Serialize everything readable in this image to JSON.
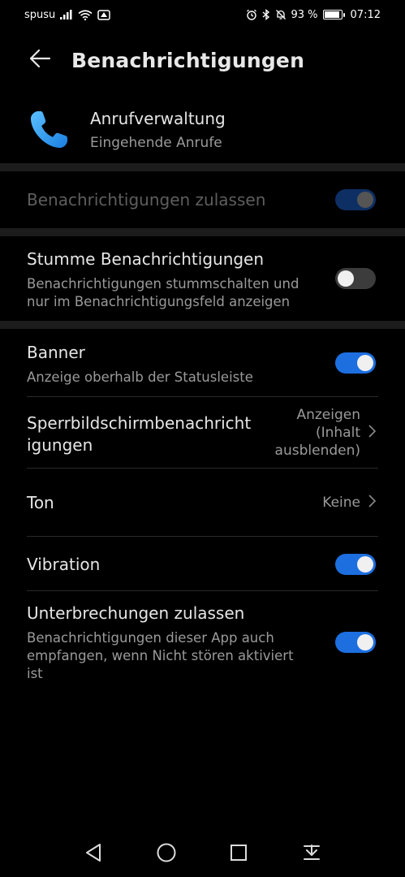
{
  "status_bar": {
    "carrier": "spusu",
    "battery": "93 %",
    "battery_level": 0.93,
    "time": "07:12"
  },
  "header": {
    "title": "Benachrichtigungen",
    "back_icon": "arrow-left-icon"
  },
  "app": {
    "name": "Anrufverwaltung",
    "subtitle": "Eingehende Anrufe",
    "icon": "phone-handset-icon",
    "icon_color": "#2a9df4"
  },
  "settings": {
    "allow": {
      "title": "Benachrichtigungen zulassen",
      "state": "on",
      "enabled": false
    },
    "silent": {
      "title": "Stumme Benachrichtigungen",
      "subtitle_line1": "Benachrichtigungen stummschalten und",
      "subtitle_line2": "nur im Benachrichtigungsfeld anzeigen",
      "state": "off"
    },
    "banner": {
      "title": "Banner",
      "subtitle": "Anzeige oberhalb der Statusleiste",
      "state": "on"
    },
    "lockscreen": {
      "title_line1": "Sperrbildschirmbenachricht",
      "title_line2": "igungen",
      "value_line1": "Anzeigen",
      "value_line2": "(Inhalt",
      "value_line3": "ausblenden)"
    },
    "tone": {
      "title": "Ton",
      "value": "Keine"
    },
    "vibration": {
      "title": "Vibration",
      "state": "on"
    },
    "interruptions": {
      "title": "Unterbrechungen zulassen",
      "subtitle_line1": "Benachrichtigungen dieser App auch",
      "subtitle_line2": "empfangen, wenn Nicht stören aktiviert",
      "subtitle_line3": "ist",
      "state": "on"
    }
  },
  "colors": {
    "accent": "#1d6fe0",
    "background": "#000000",
    "section_band": "#1c1c1c"
  },
  "navbar": {
    "icons": [
      "back-triangle-icon",
      "home-circle-icon",
      "recents-square-icon",
      "notification-pulldown-icon"
    ]
  }
}
